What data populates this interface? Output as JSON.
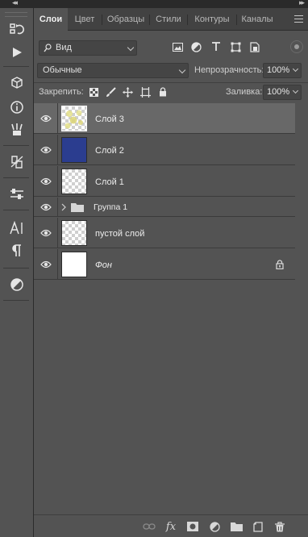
{
  "tabs": [
    {
      "label": "Слои",
      "active": true
    },
    {
      "label": "Цвет",
      "active": false
    },
    {
      "label": "Образцы",
      "active": false
    },
    {
      "label": "Стили",
      "active": false
    },
    {
      "label": "Контуры",
      "active": false
    },
    {
      "label": "Каналы",
      "active": false
    }
  ],
  "filter": {
    "kind_label": "Вид",
    "icons": [
      "image-filter-icon",
      "adjustment-filter-icon",
      "type-filter-icon",
      "shape-filter-icon",
      "smart-object-filter-icon"
    ]
  },
  "blend": {
    "mode": "Обычные",
    "opacity_label": "Непрозрачность:",
    "opacity_value": "100%"
  },
  "lock": {
    "label": "Закрепить:",
    "fill_label": "Заливка:",
    "fill_value": "100%"
  },
  "layers": [
    {
      "name": "Слой 3",
      "type": "pixel",
      "selected": true,
      "visible": true
    },
    {
      "name": "Слой 2",
      "type": "pixel",
      "selected": false,
      "visible": true,
      "fill": "#2b3d8f"
    },
    {
      "name": "Слой 1",
      "type": "pixel",
      "selected": false,
      "visible": true
    },
    {
      "name": "Группа 1",
      "type": "group",
      "selected": false,
      "visible": true,
      "collapsed": true
    },
    {
      "name": "пустой слой",
      "type": "pixel",
      "selected": false,
      "visible": true
    },
    {
      "name": "Фон",
      "type": "background",
      "selected": false,
      "visible": true,
      "locked": true
    }
  ],
  "colors": {
    "panel": "#535353",
    "selected_row": "#686868",
    "tab_bar": "#424242",
    "layer2_fill": "#2b3d8f"
  }
}
